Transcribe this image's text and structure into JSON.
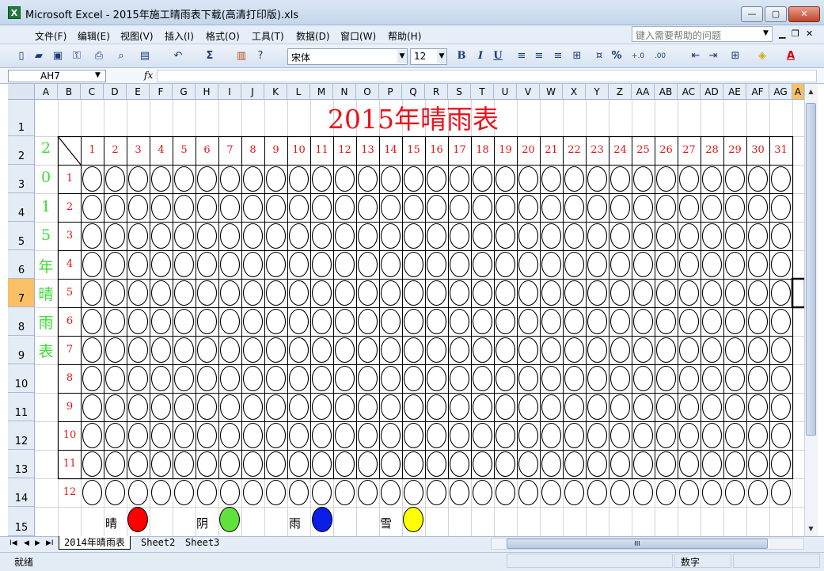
{
  "window": {
    "app_icon": "X",
    "title": "Microsoft Excel - 2015年施工晴雨表下载(高清打印版).xls",
    "controls": {
      "minimize": "—",
      "maximize": "▢",
      "close": "✕"
    }
  },
  "menu": {
    "items": [
      "文件(F)",
      "编辑(E)",
      "视图(V)",
      "插入(I)",
      "格式(O)",
      "工具(T)",
      "数据(D)",
      "窗口(W)",
      "帮助(H)"
    ],
    "help_placeholder": "键入需要帮助的问题",
    "doc_controls": [
      "▁",
      "❐",
      "✕"
    ]
  },
  "toolbar": {
    "font": "宋体",
    "size": "12",
    "bold": "B",
    "italic": "I",
    "underline": "U",
    "sum": "Σ",
    "percent": "%",
    "inc_decimal": "+.0​.00",
    "dec_decimal": ".00​→.0",
    "font_color": "A",
    "icons": [
      "new-icon",
      "open-icon",
      "save-icon",
      "permission-icon",
      "print-icon",
      "preview-icon",
      "paste-icon",
      "undo-icon",
      "sum-icon",
      "chart-icon",
      "help-icon"
    ]
  },
  "formula_bar": {
    "name_box": "AH7",
    "fx": "fx",
    "value": ""
  },
  "sheet": {
    "columns": [
      "A",
      "B",
      "C",
      "D",
      "E",
      "F",
      "G",
      "H",
      "I",
      "J",
      "K",
      "L",
      "M",
      "N",
      "O",
      "P",
      "Q",
      "R",
      "S",
      "T",
      "U",
      "V",
      "W",
      "X",
      "Y",
      "Z",
      "AA",
      "AB",
      "AC",
      "AD",
      "AE",
      "AF",
      "AG",
      "A"
    ],
    "selected_column": "A",
    "rows": [
      "1",
      "2",
      "3",
      "4",
      "5",
      "6",
      "7",
      "8",
      "9",
      "10",
      "11",
      "12",
      "13",
      "14",
      "15"
    ],
    "selected_row": "7",
    "title": "2015年晴雨表",
    "side_label": [
      "2",
      "0",
      "1",
      "5",
      "年",
      "晴",
      "雨",
      "表"
    ],
    "days": [
      "1",
      "2",
      "3",
      "4",
      "5",
      "6",
      "7",
      "8",
      "9",
      "10",
      "11",
      "12",
      "13",
      "14",
      "15",
      "16",
      "17",
      "18",
      "19",
      "20",
      "21",
      "22",
      "23",
      "24",
      "25",
      "26",
      "27",
      "28",
      "29",
      "30",
      "31"
    ],
    "months": [
      "1",
      "2",
      "3",
      "4",
      "5",
      "6",
      "7",
      "8",
      "9",
      "10",
      "11",
      "12"
    ],
    "legend": [
      {
        "label": "晴",
        "color": "#ff0000"
      },
      {
        "label": "阴",
        "color": "#5fe33c"
      },
      {
        "label": "雨",
        "color": "#0a1ee8"
      },
      {
        "label": "雪",
        "color": "#ffff00"
      }
    ]
  },
  "tabs": {
    "active": "2014年晴雨表",
    "others": [
      "Sheet2",
      "Sheet3"
    ]
  },
  "scroll": {
    "h_thumb": "III",
    "v_thumb": "≡"
  },
  "status": {
    "ready": "就绪",
    "mode": "数字"
  }
}
